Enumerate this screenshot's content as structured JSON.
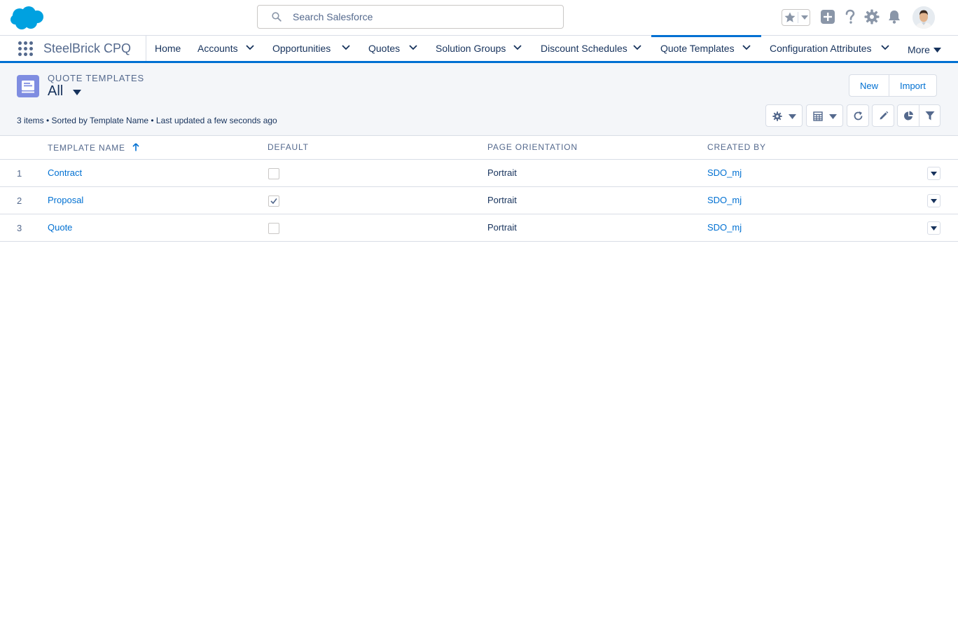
{
  "search": {
    "placeholder": "Search Salesforce"
  },
  "app": {
    "name": "SteelBrick CPQ"
  },
  "nav": {
    "items": [
      {
        "label": "Home"
      },
      {
        "label": "Accounts"
      },
      {
        "label": "Opportunities"
      },
      {
        "label": "Quotes"
      },
      {
        "label": "Solution Groups"
      },
      {
        "label": "Discount Schedules"
      },
      {
        "label": "Quote Templates",
        "active": true
      },
      {
        "label": "Configuration Attributes"
      }
    ],
    "more_label": "More"
  },
  "list": {
    "object_label": "QUOTE TEMPLATES",
    "view_name": "All",
    "info": "3 items • Sorted by Template Name • Last updated a few seconds ago",
    "buttons": {
      "new": "New",
      "import": "Import"
    }
  },
  "table": {
    "headers": [
      "TEMPLATE NAME",
      "DEFAULT",
      "PAGE ORIENTATION",
      "CREATED BY"
    ],
    "rows": [
      {
        "num": "1",
        "name": "Contract",
        "default": false,
        "orientation": "Portrait",
        "created_by": "SDO_mj"
      },
      {
        "num": "2",
        "name": "Proposal",
        "default": true,
        "orientation": "Portrait",
        "created_by": "SDO_mj"
      },
      {
        "num": "3",
        "name": "Quote",
        "default": false,
        "orientation": "Portrait",
        "created_by": "SDO_mj"
      }
    ]
  },
  "colors": {
    "brand": "#0070d2",
    "text": "#16325c",
    "muted": "#54698d",
    "object_icon": "#7f8de1"
  }
}
